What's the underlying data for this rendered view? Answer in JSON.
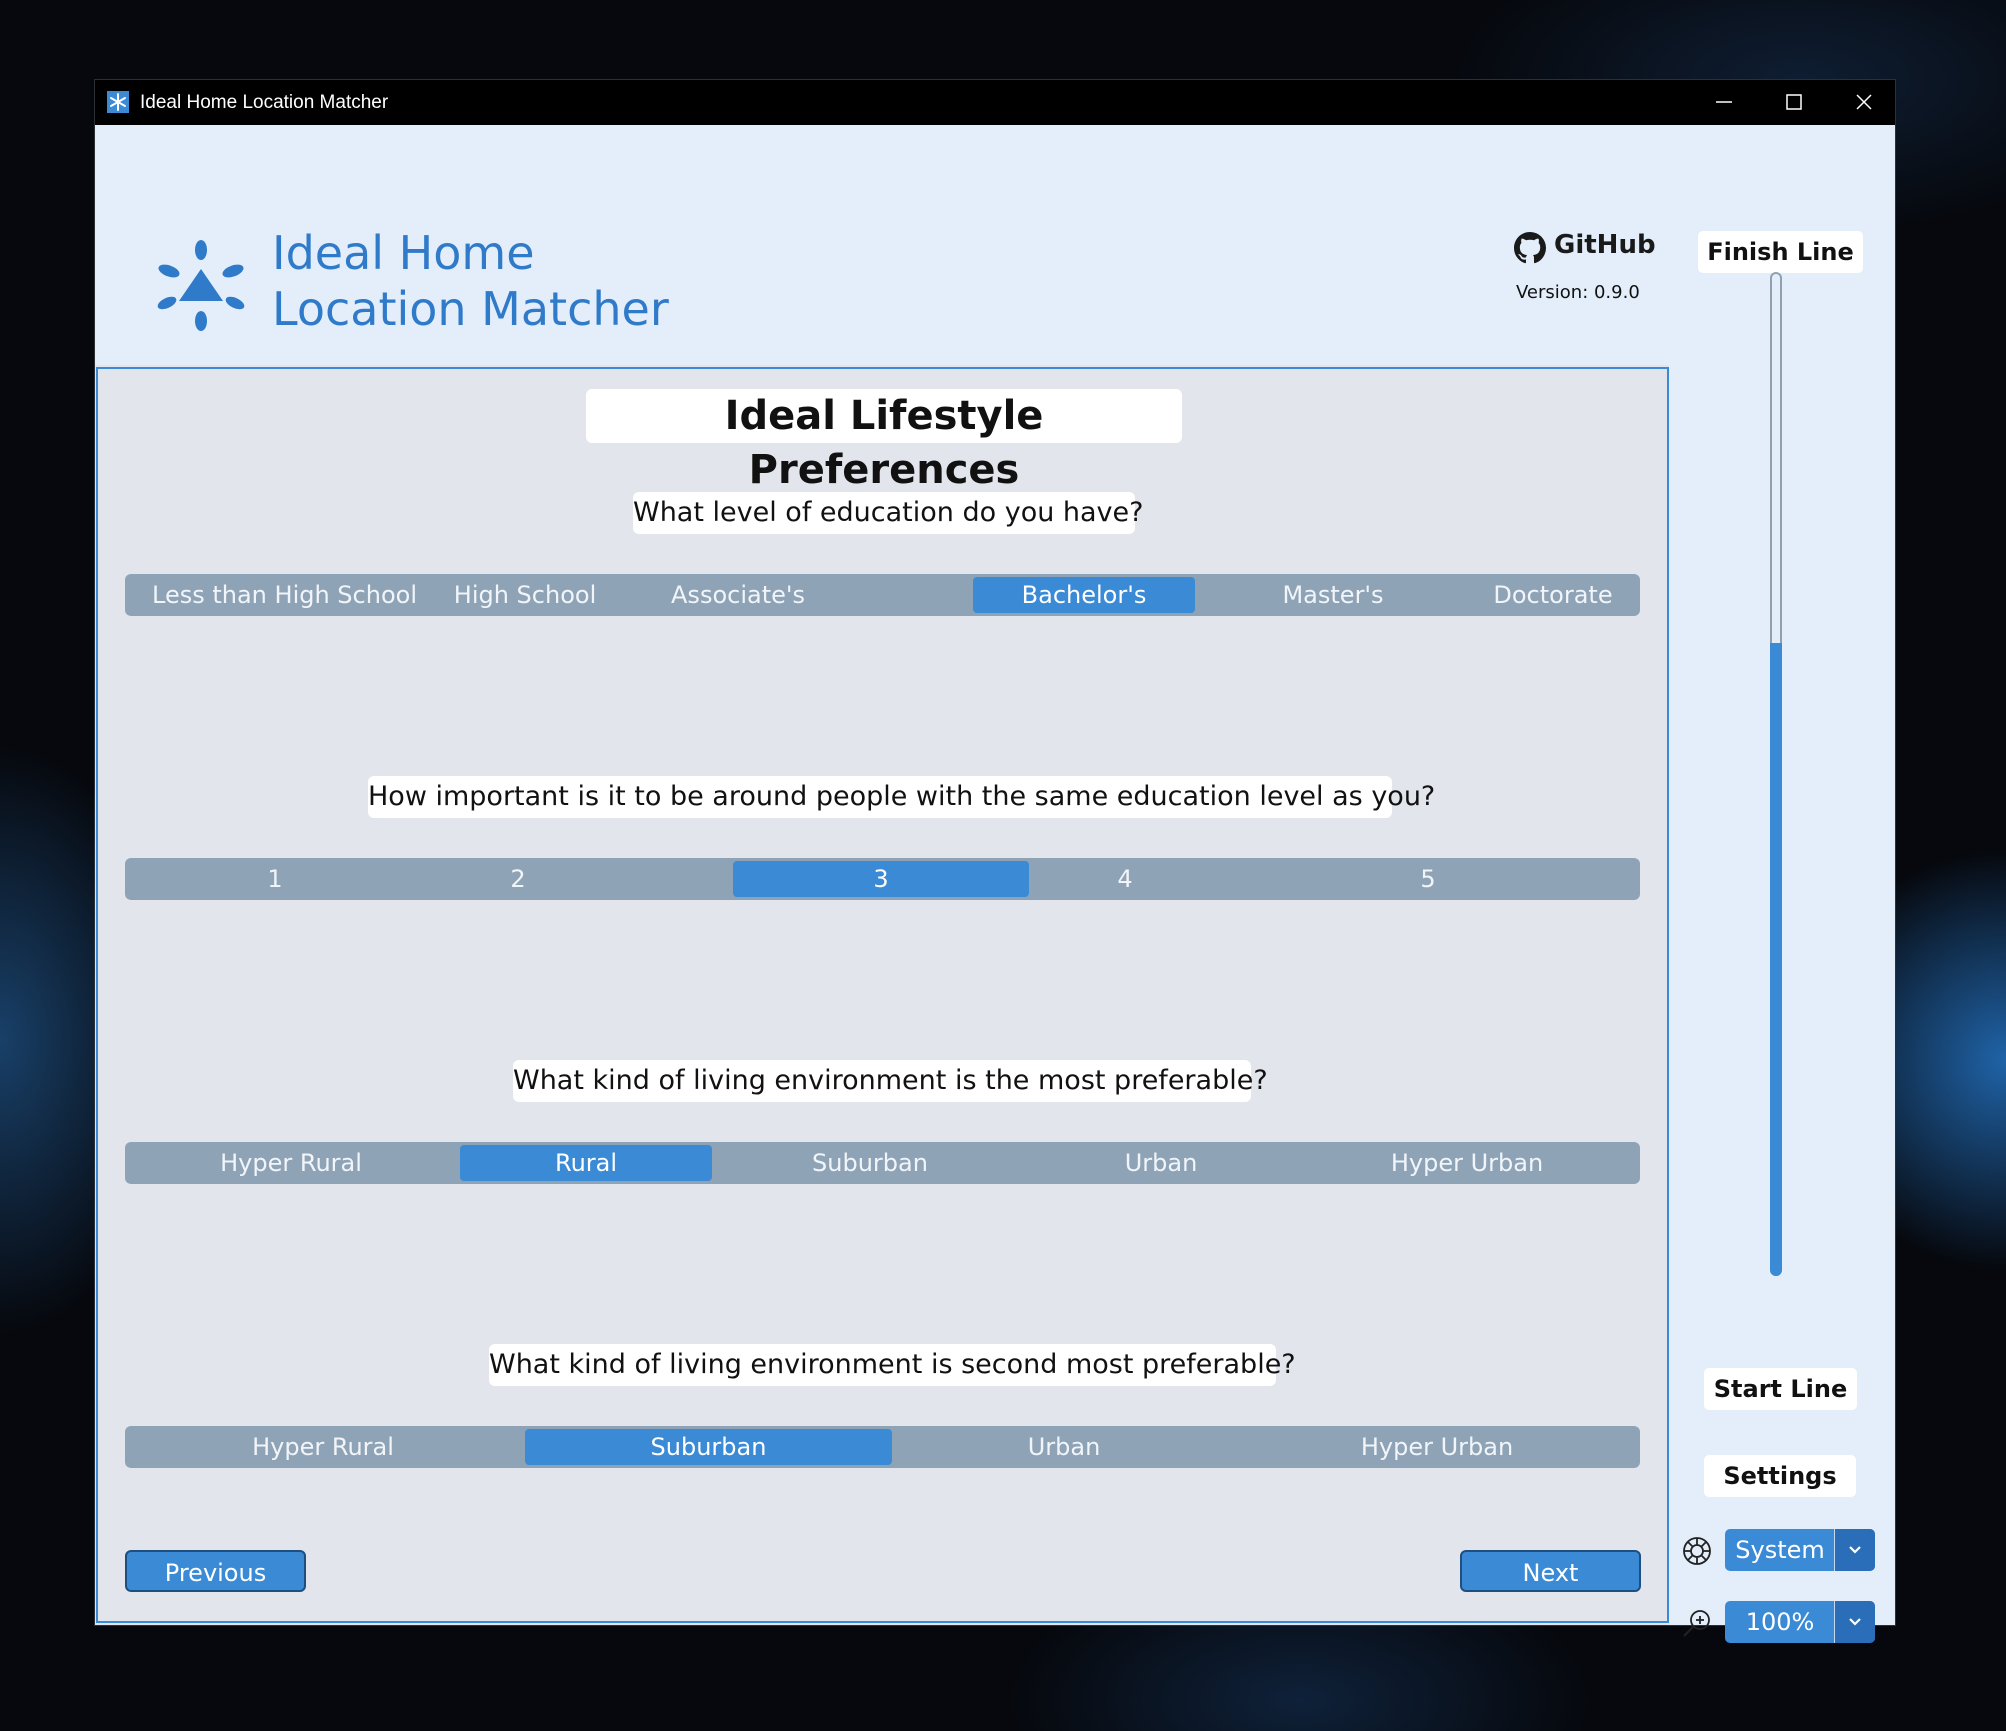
{
  "window": {
    "title": "Ideal Home Location Matcher"
  },
  "header": {
    "app_name_line1": "Ideal Home",
    "app_name_line2": "Location Matcher",
    "github_label": "GitHub",
    "version": "Version: 0.9.0"
  },
  "sidebar": {
    "finish_line": "Finish Line",
    "start_line": "Start Line",
    "settings": "Settings",
    "theme_value": "System",
    "zoom_value": "100%",
    "progress_fraction": 0.63
  },
  "main": {
    "page_title": "Ideal Lifestyle Preferences",
    "questions": [
      {
        "text": "What level of education do you have?",
        "options": [
          "Less than High School",
          "High School",
          "Associate's",
          "Bachelor's",
          "Master's",
          "Doctorate"
        ],
        "selected": "Bachelor's"
      },
      {
        "text": "How important is it to be around people with the same education level as you?",
        "options": [
          "1",
          "2",
          "3",
          "4",
          "5"
        ],
        "selected": "3"
      },
      {
        "text": "What kind of living environment is the most preferable?",
        "options": [
          "Hyper Rural",
          "Rural",
          "Suburban",
          "Urban",
          "Hyper Urban"
        ],
        "selected": "Rural"
      },
      {
        "text": "What kind of living environment is second most preferable?",
        "options": [
          "Hyper Rural",
          "Suburban",
          "Urban",
          "Hyper Urban"
        ],
        "selected": "Suburban"
      }
    ],
    "previous_label": "Previous",
    "next_label": "Next"
  },
  "colors": {
    "accent": "#3a8ad6",
    "segment_bg": "#8fa3b7",
    "header_bg": "#e3eefa",
    "content_bg": "#e2e5ec"
  }
}
